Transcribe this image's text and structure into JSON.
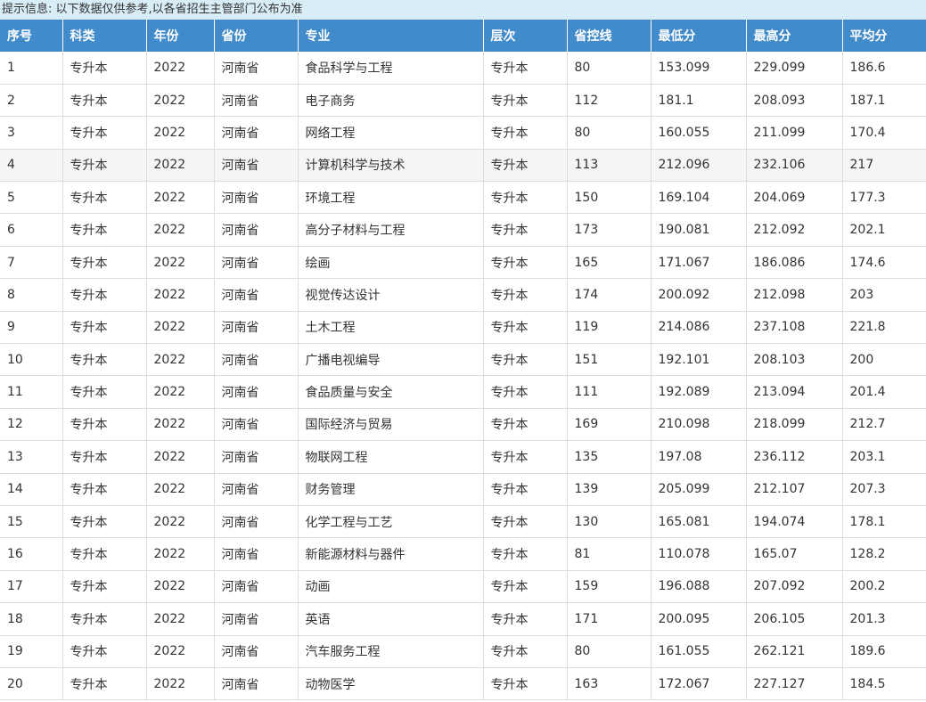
{
  "notice": "提示信息: 以下数据仅供参考,以各省招生主管部门公布为准",
  "columns": [
    "序号",
    "科类",
    "年份",
    "省份",
    "专业",
    "层次",
    "省控线",
    "最低分",
    "最高分",
    "平均分"
  ],
  "highlighted_row": 4,
  "rows": [
    [
      "1",
      "专升本",
      "2022",
      "河南省",
      "食品科学与工程",
      "专升本",
      "80",
      "153.099",
      "229.099",
      "186.6"
    ],
    [
      "2",
      "专升本",
      "2022",
      "河南省",
      "电子商务",
      "专升本",
      "112",
      "181.1",
      "208.093",
      "187.1"
    ],
    [
      "3",
      "专升本",
      "2022",
      "河南省",
      "网络工程",
      "专升本",
      "80",
      "160.055",
      "211.099",
      "170.4"
    ],
    [
      "4",
      "专升本",
      "2022",
      "河南省",
      "计算机科学与技术",
      "专升本",
      "113",
      "212.096",
      "232.106",
      "217"
    ],
    [
      "5",
      "专升本",
      "2022",
      "河南省",
      "环境工程",
      "专升本",
      "150",
      "169.104",
      "204.069",
      "177.3"
    ],
    [
      "6",
      "专升本",
      "2022",
      "河南省",
      "高分子材料与工程",
      "专升本",
      "173",
      "190.081",
      "212.092",
      "202.1"
    ],
    [
      "7",
      "专升本",
      "2022",
      "河南省",
      "绘画",
      "专升本",
      "165",
      "171.067",
      "186.086",
      "174.6"
    ],
    [
      "8",
      "专升本",
      "2022",
      "河南省",
      "视觉传达设计",
      "专升本",
      "174",
      "200.092",
      "212.098",
      "203"
    ],
    [
      "9",
      "专升本",
      "2022",
      "河南省",
      "土木工程",
      "专升本",
      "119",
      "214.086",
      "237.108",
      "221.8"
    ],
    [
      "10",
      "专升本",
      "2022",
      "河南省",
      "广播电视编导",
      "专升本",
      "151",
      "192.101",
      "208.103",
      "200"
    ],
    [
      "11",
      "专升本",
      "2022",
      "河南省",
      "食品质量与安全",
      "专升本",
      "111",
      "192.089",
      "213.094",
      "201.4"
    ],
    [
      "12",
      "专升本",
      "2022",
      "河南省",
      "国际经济与贸易",
      "专升本",
      "169",
      "210.098",
      "218.099",
      "212.7"
    ],
    [
      "13",
      "专升本",
      "2022",
      "河南省",
      "物联网工程",
      "专升本",
      "135",
      "197.08",
      "236.112",
      "203.1"
    ],
    [
      "14",
      "专升本",
      "2022",
      "河南省",
      "财务管理",
      "专升本",
      "139",
      "205.099",
      "212.107",
      "207.3"
    ],
    [
      "15",
      "专升本",
      "2022",
      "河南省",
      "化学工程与工艺",
      "专升本",
      "130",
      "165.081",
      "194.074",
      "178.1"
    ],
    [
      "16",
      "专升本",
      "2022",
      "河南省",
      "新能源材料与器件",
      "专升本",
      "81",
      "110.078",
      "165.07",
      "128.2"
    ],
    [
      "17",
      "专升本",
      "2022",
      "河南省",
      "动画",
      "专升本",
      "159",
      "196.088",
      "207.092",
      "200.2"
    ],
    [
      "18",
      "专升本",
      "2022",
      "河南省",
      "英语",
      "专升本",
      "171",
      "200.095",
      "206.105",
      "201.3"
    ],
    [
      "19",
      "专升本",
      "2022",
      "河南省",
      "汽车服务工程",
      "专升本",
      "80",
      "161.055",
      "262.121",
      "189.6"
    ],
    [
      "20",
      "专升本",
      "2022",
      "河南省",
      "动物医学",
      "专升本",
      "163",
      "172.067",
      "227.127",
      "184.5"
    ]
  ]
}
